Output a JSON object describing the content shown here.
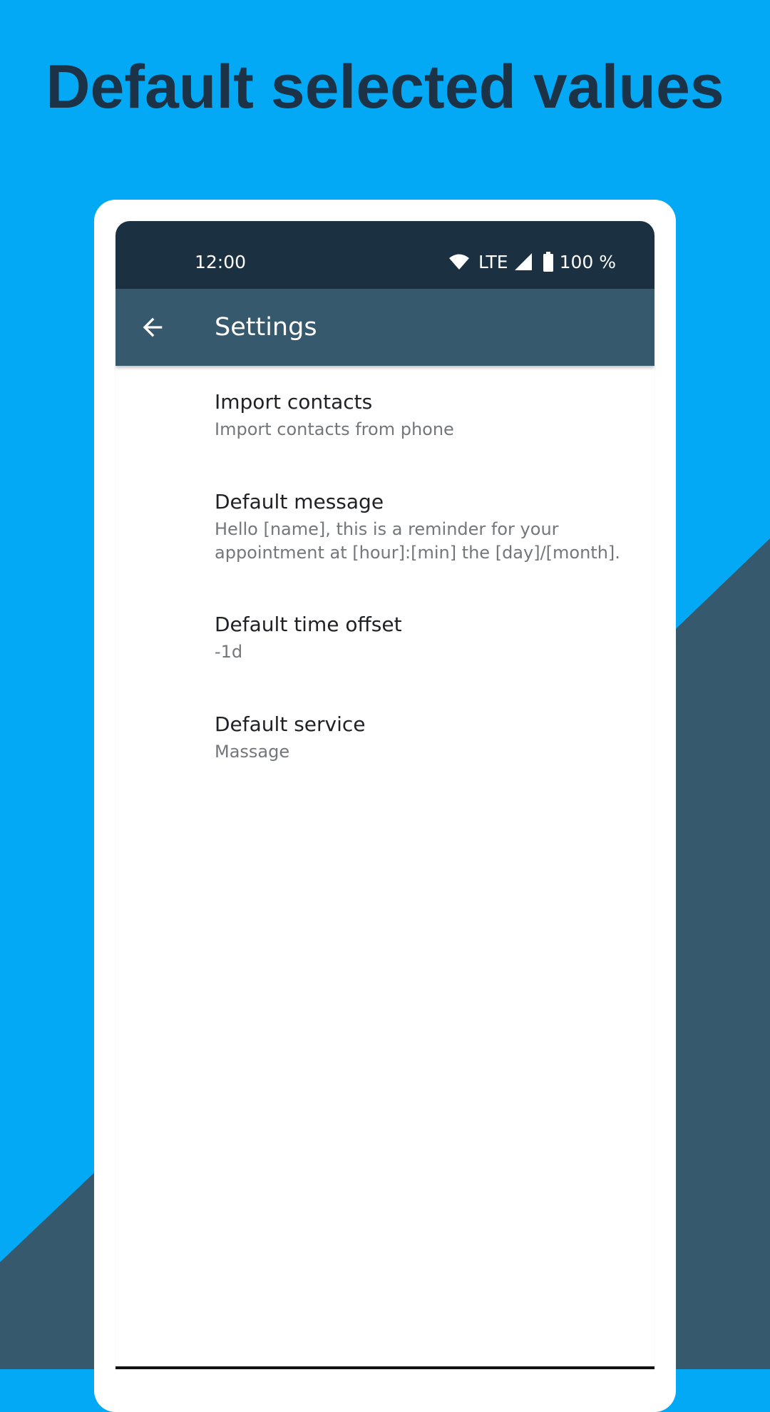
{
  "promo": {
    "headline": "Default selected values",
    "colors": {
      "background": "#03A9F4",
      "accent_shape": "#37596E",
      "headline": "#1B3247"
    }
  },
  "status_bar": {
    "time": "12:00",
    "network": "LTE",
    "battery": "100 %",
    "icons": [
      "wifi-icon",
      "signal-icon",
      "battery-icon"
    ],
    "color": "#1B3142"
  },
  "app_bar": {
    "title": "Settings",
    "nav_icon": "back-arrow-icon",
    "color": "#37596E"
  },
  "preferences": [
    {
      "title": "Import contacts",
      "summary": "Import contacts from phone"
    },
    {
      "title": "Default message",
      "summary": "Hello [name], this is a reminder for your appointment at [hour]:[min] the [day]/[month]."
    },
    {
      "title": "Default time offset",
      "summary": "-1d"
    },
    {
      "title": "Default service",
      "summary": "Massage"
    }
  ]
}
